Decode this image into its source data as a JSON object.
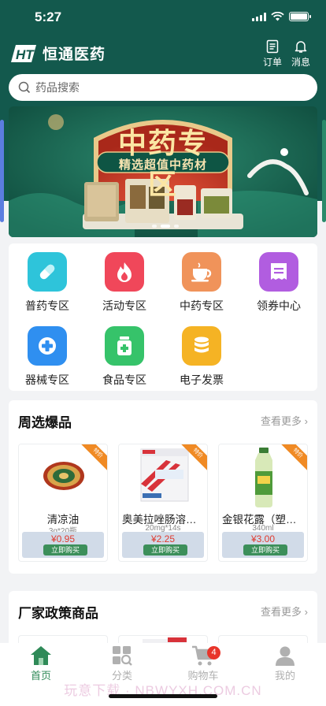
{
  "status_bar": {
    "time": "5:27"
  },
  "header": {
    "brand_name": "恒通医药",
    "orders_label": "订单",
    "messages_label": "消息"
  },
  "search": {
    "placeholder": "药品搜索"
  },
  "banner": {
    "title": "中药专区",
    "subtitle": "精选超值中药材",
    "slides": 3,
    "active_slide": 2
  },
  "categories": [
    {
      "label": "普药专区",
      "icon": "capsule-icon",
      "color": "#2ec4da"
    },
    {
      "label": "活动专区",
      "icon": "flame-icon",
      "color": "#f0475a"
    },
    {
      "label": "中药专区",
      "icon": "teacup-icon",
      "color": "#f0935a"
    },
    {
      "label": "领券中心",
      "icon": "coupon-icon",
      "color": "#b15de0"
    },
    {
      "label": "器械专区",
      "icon": "medical-cross-icon",
      "color": "#2f8ff0"
    },
    {
      "label": "食品专区",
      "icon": "nutrition-jar-icon",
      "color": "#36c36a"
    },
    {
      "label": "电子发票",
      "icon": "database-icon",
      "color": "#f5b324"
    }
  ],
  "weekly_hot": {
    "title": "周选爆品",
    "more": "查看更多",
    "products": [
      {
        "name": "清凉油",
        "spec": "3g*20瓶",
        "price": "¥0.95",
        "buy": "立即购买",
        "ribbon": "特价"
      },
      {
        "name": "奥美拉唑肠溶胶...",
        "spec": "20mg*14s",
        "price": "¥2.25",
        "buy": "立即购买",
        "ribbon": "特价"
      },
      {
        "name": "金银花露（塑瓶）",
        "spec": "340ml",
        "price": "¥3.00",
        "buy": "立即购买",
        "ribbon": "特价"
      }
    ]
  },
  "factory_policy": {
    "title": "厂家政策商品",
    "more": "查看更多"
  },
  "tabbar": {
    "items": [
      {
        "label": "首页",
        "icon": "home-icon"
      },
      {
        "label": "分类",
        "icon": "category-icon"
      },
      {
        "label": "购物车",
        "icon": "cart-icon"
      },
      {
        "label": "我的",
        "icon": "user-icon"
      }
    ],
    "active": 0,
    "cart_badge": "4"
  },
  "watermark": "玩意下载 · NBWYXH.COM.CN",
  "colors": {
    "brand_green": "#13594d",
    "accent_green": "#2f8a58",
    "price_red": "#e03a2f",
    "ribbon_orange": "#f08a24"
  }
}
